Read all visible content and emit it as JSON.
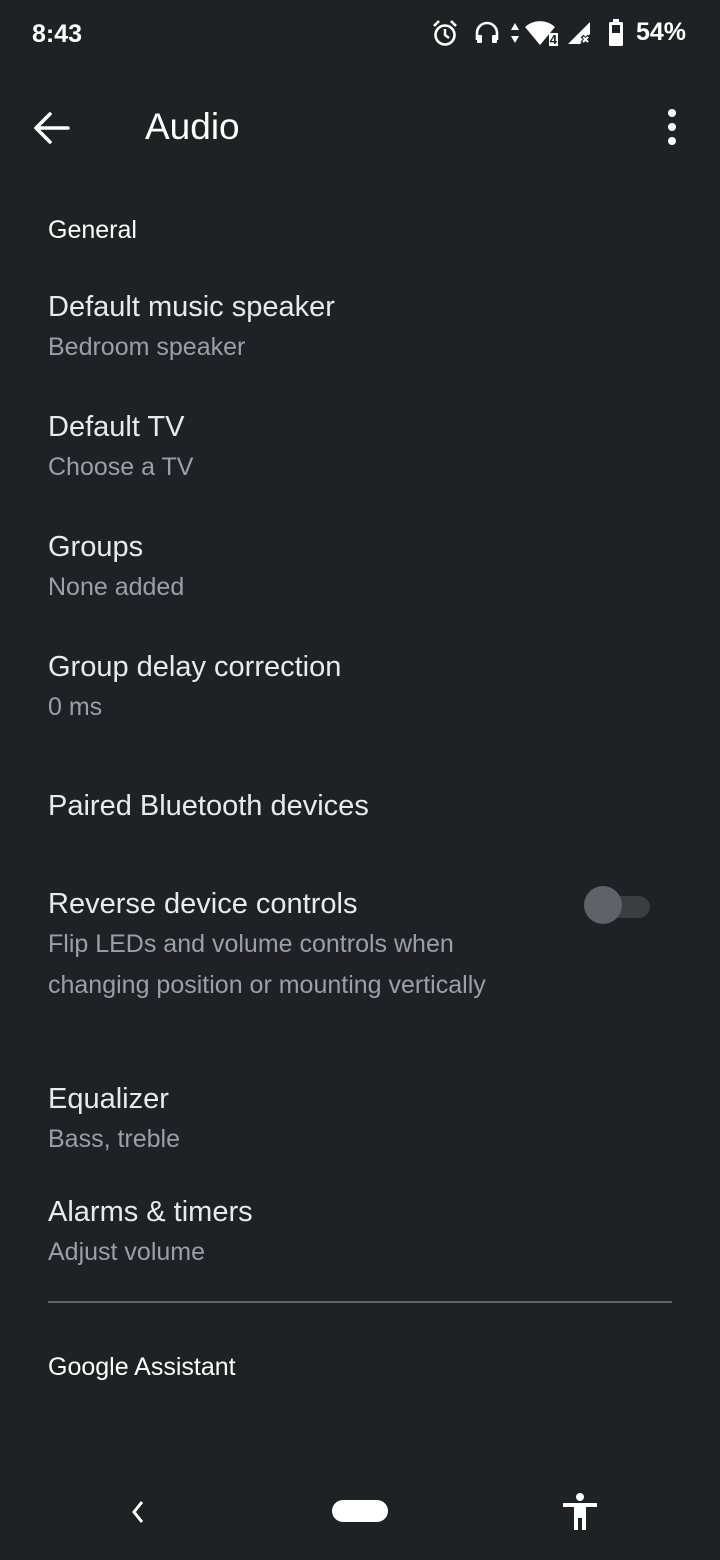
{
  "status_bar": {
    "time": "8:43",
    "icons": [
      "alarm-icon",
      "headphones-icon",
      "data-arrows-icon",
      "wifi-icon",
      "cell-signal-no-service-icon",
      "battery-icon"
    ],
    "wifi_badge": "4",
    "battery_percent": "54%"
  },
  "app_bar": {
    "title": "Audio",
    "back_icon": "arrow-left-icon",
    "more_icon": "more-vertical-icon"
  },
  "sections": {
    "general": {
      "header": "General"
    },
    "assistant": {
      "header": "Google Assistant"
    }
  },
  "items": [
    {
      "title": "Default music speaker",
      "subtitle": "Bedroom speaker"
    },
    {
      "title": "Default TV",
      "subtitle": "Choose a TV"
    },
    {
      "title": "Groups",
      "subtitle": "None added"
    },
    {
      "title": "Group delay correction",
      "subtitle": "0 ms"
    },
    {
      "title": "Paired Bluetooth devices"
    },
    {
      "title": "Reverse device controls",
      "subtitle": "Flip LEDs and volume controls when changing position or mounting vertically",
      "toggle": false
    },
    {
      "title": "Equalizer",
      "subtitle": "Bass, treble"
    },
    {
      "title": "Alarms & timers",
      "subtitle": "Adjust volume"
    }
  ],
  "nav_bar": {
    "back_icon": "nav-back-icon",
    "home_icon": "home-pill-icon",
    "accessibility_icon": "accessibility-icon"
  }
}
